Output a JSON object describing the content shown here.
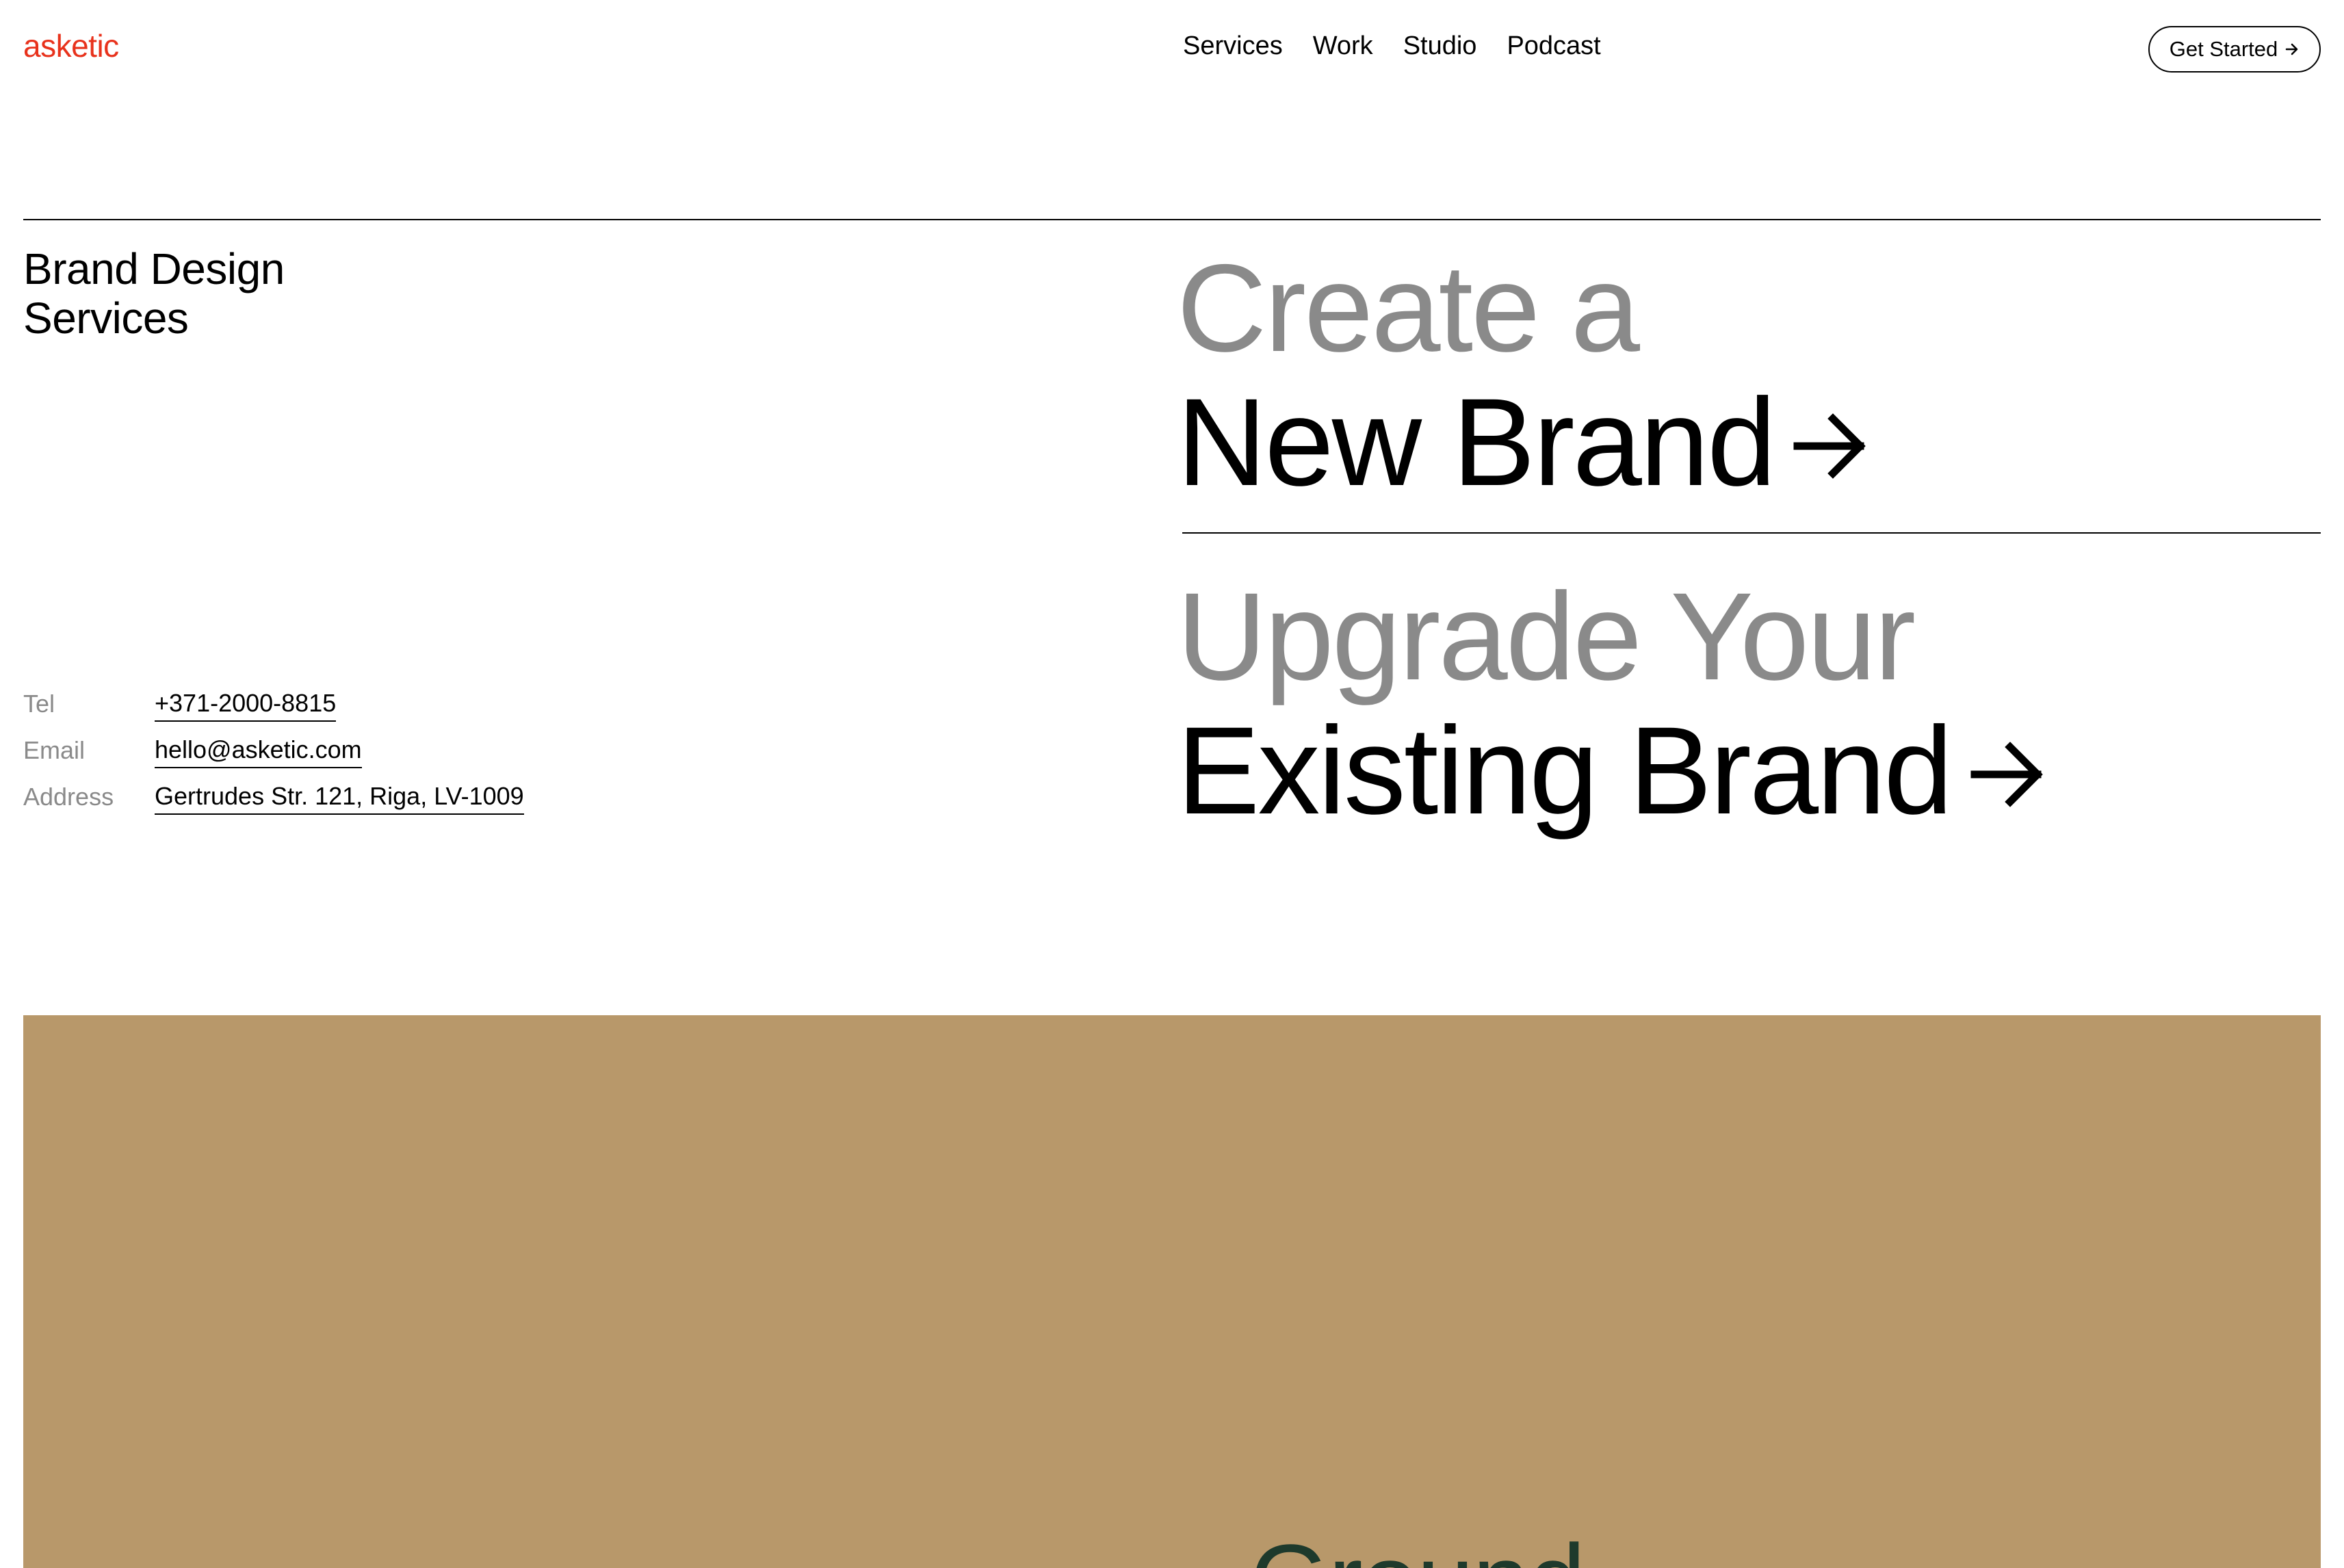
{
  "header": {
    "logo": "asketic",
    "logo_color": "#e8321c",
    "nav": [
      "Services",
      "Work",
      "Studio",
      "Podcast"
    ],
    "cta_label": "Get Started",
    "cta_icon": "arrow-right-icon"
  },
  "intro": {
    "title_line1": "Brand Design",
    "title_line2": "Services"
  },
  "contacts": [
    {
      "label": "Tel",
      "value": "+371-2000-8815"
    },
    {
      "label": "Email",
      "value": "hello@asketic.com"
    },
    {
      "label": "Address",
      "value": "Gertrudes Str. 121, Riga, LV-1009"
    }
  ],
  "offers": [
    {
      "line1": "Create a",
      "line2": "New Brand",
      "icon": "arrow-right-icon"
    },
    {
      "line1": "Upgrade Your",
      "line2": "Existing Brand",
      "icon": "arrow-right-icon"
    }
  ],
  "feature": {
    "background": "#b8986a",
    "accent": "#1e3a2c",
    "text": "Ground"
  },
  "colors": {
    "muted_text": "#8a8a8a",
    "primary_text": "#000000"
  }
}
